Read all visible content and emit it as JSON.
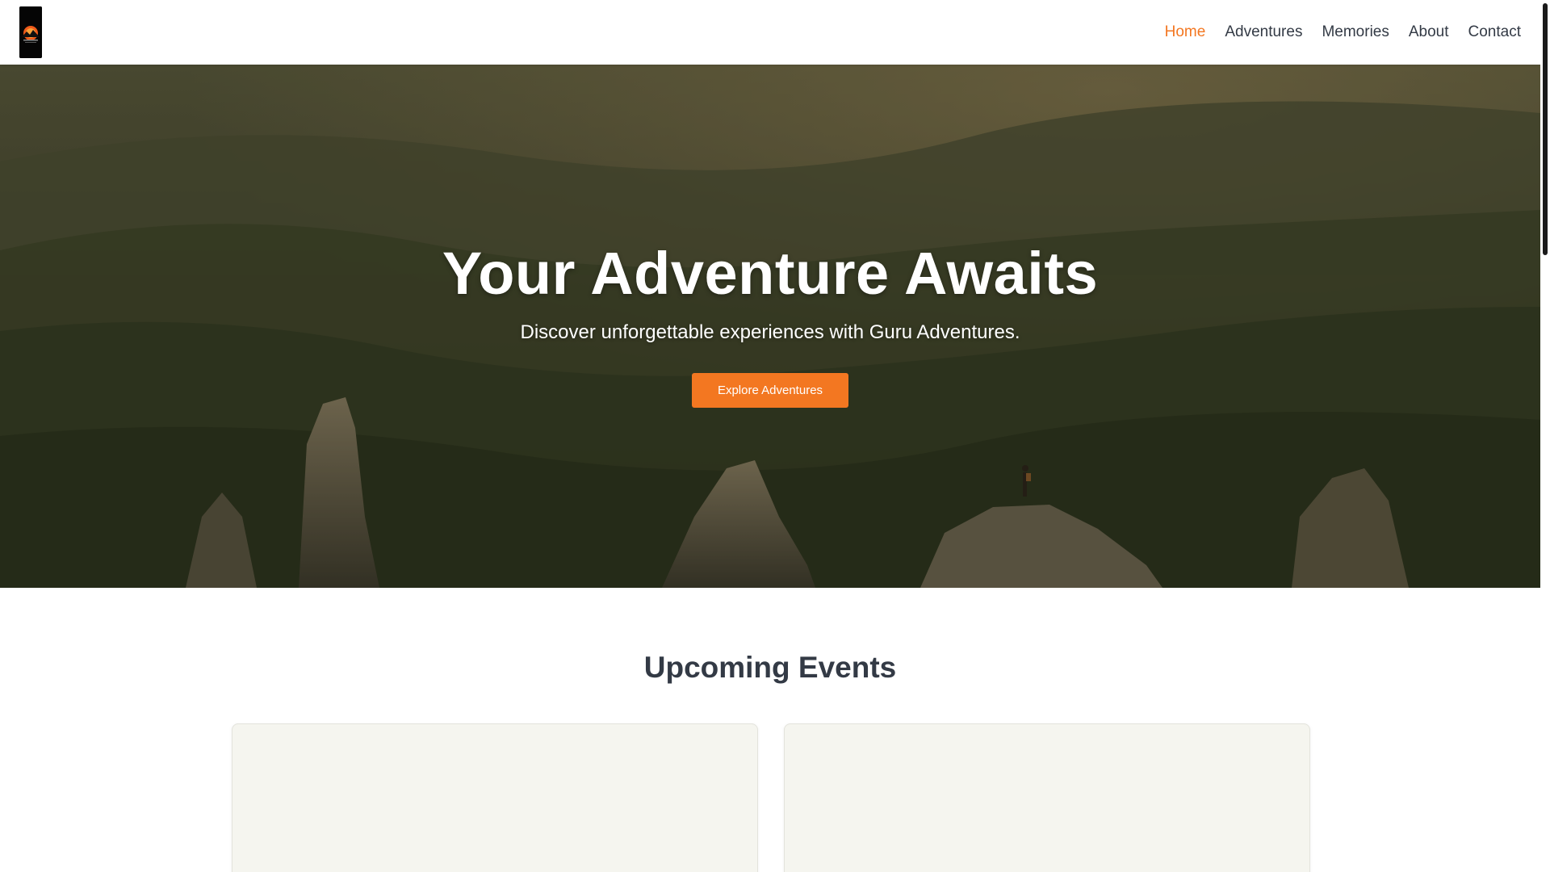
{
  "nav": {
    "items": [
      {
        "label": "Home",
        "active": true
      },
      {
        "label": "Adventures",
        "active": false
      },
      {
        "label": "Memories",
        "active": false
      },
      {
        "label": "About",
        "active": false
      },
      {
        "label": "Contact",
        "active": false
      }
    ]
  },
  "hero": {
    "title": "Your Adventure Awaits",
    "subtitle": "Discover unforgettable experiences with Guru Adventures.",
    "button_label": "Explore Adventures"
  },
  "events": {
    "title": "Upcoming Events"
  },
  "colors": {
    "accent": "#f37721",
    "text_dark": "#333a45",
    "card_bg": "#f5f5ef"
  },
  "icons": {
    "logo": "sunset-logo"
  }
}
